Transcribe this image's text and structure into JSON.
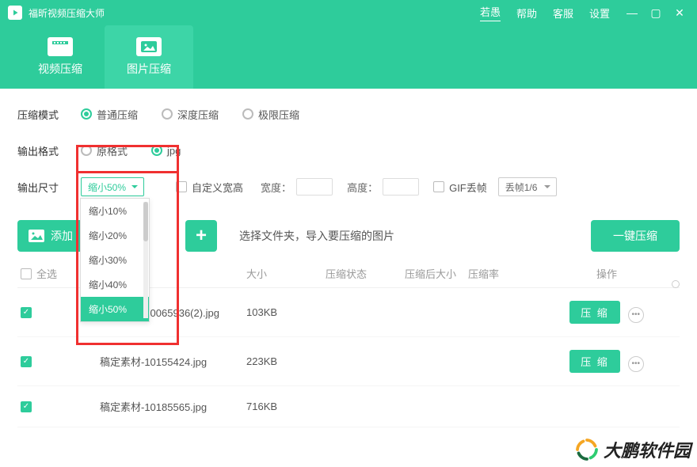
{
  "titlebar": {
    "app_name": "福昕视频压缩大师",
    "links": {
      "promo": "若愚",
      "help": "帮助",
      "service": "客服",
      "settings": "设置"
    }
  },
  "tabs": {
    "video": "视频压缩",
    "image": "图片压缩"
  },
  "modes": {
    "label": "压缩模式",
    "opt_normal": "普通压缩",
    "opt_deep": "深度压缩",
    "opt_extreme": "极限压缩"
  },
  "format": {
    "label": "输出格式",
    "opt_original": "原格式",
    "opt_jpg": "jpg"
  },
  "size": {
    "label": "输出尺寸",
    "selected": "缩小50%",
    "options": [
      "缩小10%",
      "缩小20%",
      "缩小30%",
      "缩小40%",
      "缩小50%"
    ],
    "custom_wh": "自定义宽高",
    "width_lbl": "宽度：",
    "height_lbl": "高度：",
    "gif_drop": "GIF丢帧",
    "drop_selected": "丢帧1/6"
  },
  "actions": {
    "add_file": "添加",
    "folder_hint": "选择文件夹，导入要压缩的图片",
    "go": "一键压缩"
  },
  "table": {
    "select_all": "全选",
    "col_size": "大小",
    "col_status": "压缩状态",
    "col_after": "压缩后大小",
    "col_rate": "压缩率",
    "col_op": "操作",
    "row_btn": "压 缩",
    "rows": [
      {
        "name": "稿定素材-10065936(2).jpg",
        "size": "103KB"
      },
      {
        "name": "稿定素材-10155424.jpg",
        "size": "223KB"
      },
      {
        "name": "稿定素材-10185565.jpg",
        "size": "716KB"
      }
    ]
  },
  "watermark": "大鹏软件园"
}
